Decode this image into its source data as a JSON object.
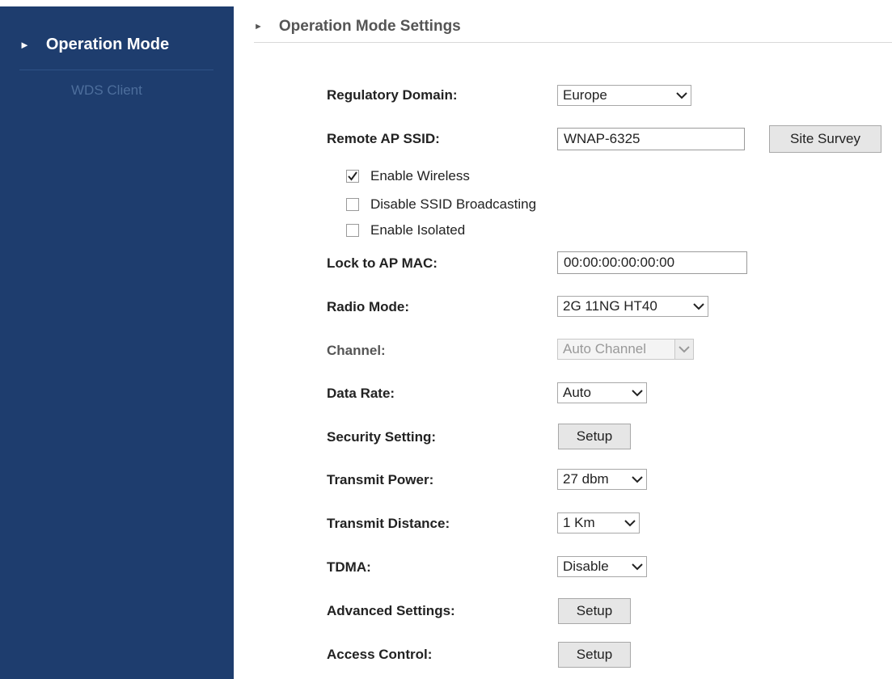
{
  "sidebar": {
    "active_item": "Operation Mode",
    "sub_item": "WDS Client"
  },
  "header": {
    "title": "Operation Mode Settings"
  },
  "form": {
    "regulatory_domain": {
      "label": "Regulatory Domain:",
      "value": "Europe"
    },
    "remote_ap_ssid": {
      "label": "Remote AP SSID:",
      "value": "WNAP-6325",
      "button": "Site Survey"
    },
    "checkboxes": [
      {
        "label": "Enable Wireless",
        "checked": true
      },
      {
        "label": "Disable SSID Broadcasting",
        "checked": false
      },
      {
        "label": "Enable Isolated",
        "checked": false
      }
    ],
    "lock_to_ap_mac": {
      "label": "Lock to AP MAC:",
      "value": "00:00:00:00:00:00"
    },
    "radio_mode": {
      "label": "Radio Mode:",
      "value": "2G 11NG HT40"
    },
    "channel": {
      "label": "Channel:",
      "value": "Auto Channel",
      "disabled": true
    },
    "data_rate": {
      "label": "Data Rate:",
      "value": "Auto"
    },
    "security_setting": {
      "label": "Security Setting:",
      "button": "Setup"
    },
    "transmit_power": {
      "label": "Transmit Power:",
      "value": "27 dbm"
    },
    "transmit_distance": {
      "label": "Transmit Distance:",
      "value": "1 Km"
    },
    "tdma": {
      "label": "TDMA:",
      "value": "Disable"
    },
    "advanced_settings": {
      "label": "Advanced Settings:",
      "button": "Setup"
    },
    "access_control": {
      "label": "Access Control:",
      "button": "Setup"
    }
  },
  "colors": {
    "sidebar_bg": "#1e3d6e",
    "sidebar_sub_text": "#4d6e9c"
  }
}
